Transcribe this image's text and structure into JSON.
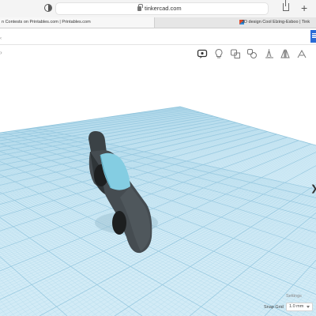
{
  "browser": {
    "url": "tinkercad.com",
    "tabs": [
      {
        "title": "n Contests on Printables.com | Printables.com"
      },
      {
        "title": "3D design Cool Elzing-Esboo | Tink"
      }
    ],
    "new_tab_symbol": "+"
  },
  "icons": {
    "sidebar": "sidebar-icon",
    "lock": "lock-icon",
    "share": "share-icon",
    "apps": "apps-grid-icon",
    "note": "note-icon",
    "light": "lightbulb-icon",
    "group": "group-icon",
    "ungroup": "ungroup-icon",
    "align": "align-icon",
    "mirror": "mirror-icon",
    "cruise": "cruise-icon"
  },
  "header": {
    "left_mark": "‹"
  },
  "toolbar": {
    "left_chevron": "›"
  },
  "viewport": {
    "side_handle": "❯",
    "settings_label": "Settings",
    "snap_grid_label": "Snap Grid",
    "snap_grid_value": "1.0 mm"
  },
  "colors": {
    "workplane": "#cfe9f5",
    "grid_line": "#a9d3e8",
    "car_body": "#3e4448",
    "windshield": "#7fcbe0",
    "accent": "#2a6bd6"
  }
}
